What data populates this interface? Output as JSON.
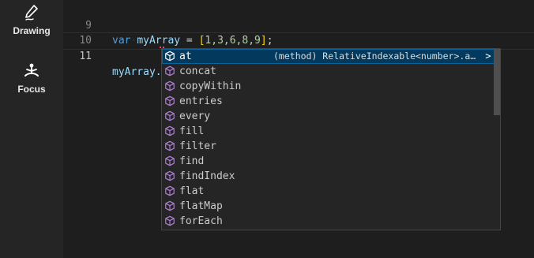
{
  "sidebar": {
    "items": [
      {
        "label": "Drawing",
        "icon": "pen-icon"
      },
      {
        "label": "Focus",
        "icon": "meditation-icon"
      }
    ]
  },
  "editor": {
    "lines": [
      {
        "number": "9",
        "keyword": "var",
        "name": "myArray",
        "assign": " = ",
        "open": "[",
        "values": "1,3,6,8,9",
        "close": "]",
        "end": ";"
      },
      {
        "number": "10"
      },
      {
        "number": "11",
        "text": "myArray."
      }
    ]
  },
  "suggest": {
    "items": [
      {
        "label": "at",
        "detail": "(method) RelativeIndexable<number>.at(index: number): number | undefined",
        "more": ">"
      },
      {
        "label": "concat"
      },
      {
        "label": "copyWithin"
      },
      {
        "label": "entries"
      },
      {
        "label": "every"
      },
      {
        "label": "fill"
      },
      {
        "label": "filter"
      },
      {
        "label": "find"
      },
      {
        "label": "findIndex"
      },
      {
        "label": "flat"
      },
      {
        "label": "flatMap"
      },
      {
        "label": "forEach"
      }
    ],
    "colors": {
      "icon": "#b180d7",
      "selected_bg": "#04395e",
      "selected_border": "#0e639c"
    }
  }
}
